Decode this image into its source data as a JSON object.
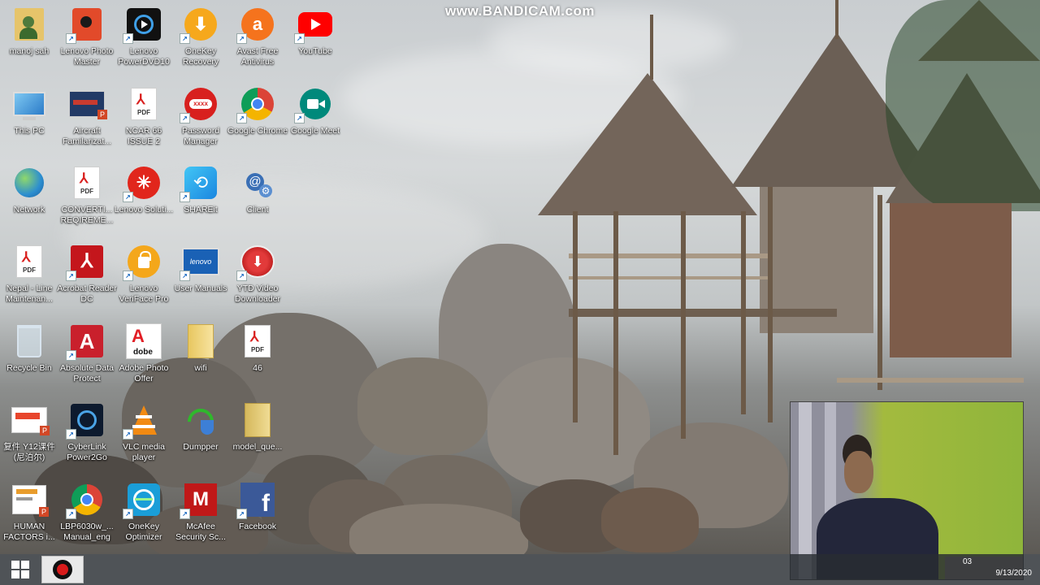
{
  "watermark": "www.BANDICAM.com",
  "desktop_icons": [
    {
      "id": "manoj",
      "label": "manoj sah",
      "icon": "user-folder-icon"
    },
    {
      "id": "photomaster",
      "label": "Lenovo Photo Master",
      "icon": "photomaster-icon"
    },
    {
      "id": "powerdvd",
      "label": "Lenovo PowerDVD10",
      "icon": "powerdvd-icon"
    },
    {
      "id": "onekey-recovery",
      "label": "OneKey Recovery",
      "icon": "onekey-recovery-icon"
    },
    {
      "id": "avast",
      "label": "Avast Free Antivirus",
      "icon": "avast-icon"
    },
    {
      "id": "youtube",
      "label": "YouTube",
      "icon": "youtube-icon"
    },
    {
      "id": "thispc",
      "label": "This PC",
      "icon": "computer-icon"
    },
    {
      "id": "aircraft",
      "label": "Aircraft Familarizat...",
      "icon": "ppt-icon"
    },
    {
      "id": "ncar",
      "label": "NCAR 66 ISSUE 2",
      "icon": "pdf-icon"
    },
    {
      "id": "password",
      "label": "Password Manager",
      "icon": "password-manager-icon"
    },
    {
      "id": "chrome",
      "label": "Google Chrome",
      "icon": "chrome-icon"
    },
    {
      "id": "meet",
      "label": "Google Meet",
      "icon": "google-meet-icon"
    },
    {
      "id": "network",
      "label": "Network",
      "icon": "network-globe-icon"
    },
    {
      "id": "converti",
      "label": "CONVERTI... REQIREME...",
      "icon": "pdf-icon"
    },
    {
      "id": "lenovo-solution",
      "label": "Lenovo Soluti...",
      "icon": "lenovo-solution-icon"
    },
    {
      "id": "shareit",
      "label": "SHAREit",
      "icon": "shareit-icon"
    },
    {
      "id": "client",
      "label": "Client",
      "icon": "client-gear-icon"
    },
    {
      "id": "nepal",
      "label": "Nepal - Line Maintenan...",
      "icon": "pdf-icon"
    },
    {
      "id": "acrobat",
      "label": "Acrobat Reader DC",
      "icon": "acrobat-icon"
    },
    {
      "id": "veriface",
      "label": "Lenovo VeriFace Pro",
      "icon": "veriface-lock-icon"
    },
    {
      "id": "usermanuals",
      "label": "User Manuals",
      "icon": "lenovo-monitor-icon"
    },
    {
      "id": "ytd",
      "label": "YTD Video Downloader",
      "icon": "ytd-icon"
    },
    {
      "id": "recyclebin",
      "label": "Recycle Bin",
      "icon": "recycle-bin-icon"
    },
    {
      "id": "absolute",
      "label": "Absolute Data Protect",
      "icon": "absolute-icon"
    },
    {
      "id": "photoshop",
      "label": "Adobe Photo Offer",
      "icon": "adobe-icon"
    },
    {
      "id": "wifi",
      "label": "wifi",
      "icon": "folder-icon"
    },
    {
      "id": "pdf46",
      "label": "46",
      "icon": "pdf-icon"
    },
    {
      "id": "chinese",
      "label": "复件 Y12课件(尼泊尔)",
      "icon": "ppt-icon"
    },
    {
      "id": "power2go",
      "label": "CyberLink Power2Go",
      "icon": "power2go-icon"
    },
    {
      "id": "vlc",
      "label": "VLC media player",
      "icon": "vlc-cone-icon"
    },
    {
      "id": "dumpper",
      "label": "Dumpper",
      "icon": "wifi-shield-icon"
    },
    {
      "id": "modelque",
      "label": "model_que...",
      "icon": "folder-icon"
    },
    {
      "id": "human",
      "label": "HUMAN FACTORS i...",
      "icon": "ppt-icon"
    },
    {
      "id": "lbp",
      "label": "LBP6030w_... Manual_eng",
      "icon": "chrome-icon"
    },
    {
      "id": "optimizer",
      "label": "OneKey Optimizer",
      "icon": "optimizer-icon"
    },
    {
      "id": "mcafee",
      "label": "McAfee Security Sc...",
      "icon": "mcafee-icon"
    },
    {
      "id": "facebook",
      "label": "Facebook",
      "icon": "facebook-icon"
    }
  ],
  "taskbar": {
    "start_icon": "windows-logo-icon",
    "record_icon": "record-icon",
    "tray_fragment": "03",
    "clock_date": "9/13/2020"
  },
  "colors": {
    "taskbar": "#2a2d32",
    "record": "#d81b1b",
    "youtube": "#ff0000",
    "facebook": "#3b5998"
  }
}
